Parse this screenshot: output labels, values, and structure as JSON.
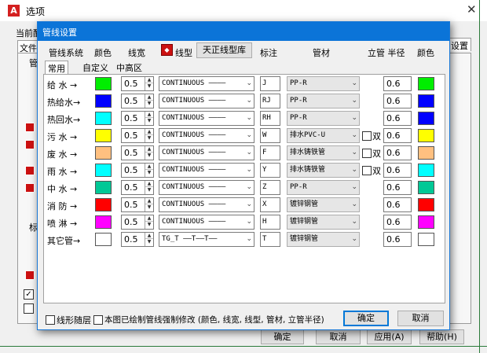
{
  "parent_window": {
    "title": "选项",
    "close_glyph": "✕",
    "current_label": "当前酷",
    "tab_partial": "文件",
    "tab_right_partial": "设置",
    "partial_labels": [
      "管",
      "标"
    ],
    "buttons": {
      "ok": "确定",
      "cancel": "取消",
      "apply": "应用(A)",
      "help": "帮助(H)"
    }
  },
  "dialog": {
    "title": "管线设置",
    "headers": {
      "system": "管线系统",
      "color": "颜色",
      "width": "线宽",
      "linetype": "线型",
      "linetype_lib": "天正线型库",
      "mark": "标注",
      "material": "管材",
      "riser_radius": "立管 半径",
      "color2": "颜色"
    },
    "tabs": [
      "常用",
      "自定义",
      "中高区"
    ],
    "rows": [
      {
        "label": "给 水 →",
        "color": "#00ee00",
        "width": "0.5",
        "linetype": "CONTINUOUS ————",
        "mark": "J",
        "material": "PP-R",
        "double": false,
        "double_label": "",
        "radius": "0.6",
        "color2": "#00ee00"
      },
      {
        "label": "热给水→",
        "color": "#0000ff",
        "width": "0.5",
        "linetype": "CONTINUOUS ————",
        "mark": "RJ",
        "material": "PP-R",
        "double": false,
        "double_label": "",
        "radius": "0.6",
        "color2": "#0000ff"
      },
      {
        "label": "热回水→",
        "color": "#00ffff",
        "width": "0.5",
        "linetype": "CONTINUOUS ————",
        "mark": "RH",
        "material": "PP-R",
        "double": false,
        "double_label": "",
        "radius": "0.6",
        "color2": "#0000ff"
      },
      {
        "label": "污 水 →",
        "color": "#ffff00",
        "width": "0.5",
        "linetype": "CONTINUOUS ————",
        "mark": "W",
        "material": "排水PVC-U",
        "double": true,
        "double_label": "双",
        "radius": "0.6",
        "color2": "#ffff00"
      },
      {
        "label": "废 水 →",
        "color": "#ffc080",
        "width": "0.5",
        "linetype": "CONTINUOUS ————",
        "mark": "F",
        "material": "排水铸铁管",
        "double": true,
        "double_label": "双",
        "radius": "0.6",
        "color2": "#ffc080"
      },
      {
        "label": "雨 水 →",
        "color": "#00ffff",
        "width": "0.5",
        "linetype": "CONTINUOUS ————",
        "mark": "Y",
        "material": "排水铸铁管",
        "double": true,
        "double_label": "双",
        "radius": "0.6",
        "color2": "#00ffff"
      },
      {
        "label": "中 水 →",
        "color": "#00c896",
        "width": "0.5",
        "linetype": "CONTINUOUS ————",
        "mark": "Z",
        "material": "PP-R",
        "double": false,
        "double_label": "",
        "radius": "0.6",
        "color2": "#00c896"
      },
      {
        "label": "消 防 →",
        "color": "#ff0000",
        "width": "0.5",
        "linetype": "CONTINUOUS ————",
        "mark": "X",
        "material": "镀锌钢管",
        "double": false,
        "double_label": "",
        "radius": "0.6",
        "color2": "#ff0000"
      },
      {
        "label": "喷 淋 →",
        "color": "#ff00ff",
        "width": "0.5",
        "linetype": "CONTINUOUS ————",
        "mark": "H",
        "material": "镀锌钢管",
        "double": false,
        "double_label": "",
        "radius": "0.6",
        "color2": "#ff00ff"
      },
      {
        "label": "其它管→",
        "color": "#ffffff",
        "width": "0.5",
        "linetype": "TG_T ——T——T——",
        "mark": "T",
        "material": "镀锌钢管",
        "double": false,
        "double_label": "",
        "radius": "0.6",
        "color2": "#ffffff"
      }
    ],
    "footer": {
      "layer_check": "线形随层",
      "force_check": "本图已绘制管线强制修改 (颜色, 线宽, 线型, 管材, 立管半径)",
      "ok": "确定",
      "cancel": "取消"
    }
  }
}
